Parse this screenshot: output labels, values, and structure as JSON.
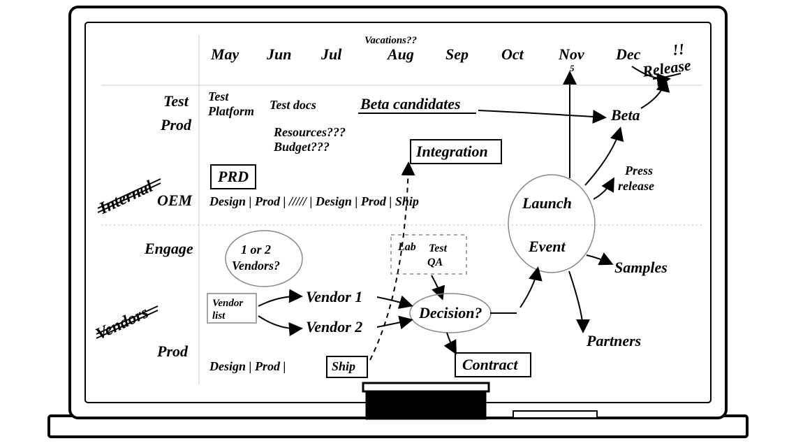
{
  "months": [
    "May",
    "Jun",
    "Jul",
    "Aug",
    "Sep",
    "Oct",
    "Nov",
    "Dec"
  ],
  "annotations": {
    "vacations": "Vacations??",
    "nov5": "5",
    "bang": "!!",
    "release": "Release"
  },
  "rows": {
    "internal_header": "Internal",
    "test": "Test",
    "prod1": "Prod",
    "oem": "OEM",
    "engage": "Engage",
    "vendors_header": "Vendors",
    "prod2": "Prod"
  },
  "labels": {
    "test_platform_1": "Test",
    "test_platform_2": "Platform",
    "test_docs": "Test docs",
    "beta_candidates": "Beta candidates",
    "beta": "Beta",
    "resources": "Resources???",
    "budget": "Budget???",
    "prd": "PRD",
    "integration": "Integration",
    "press_release_1": "Press",
    "press_release_2": "release",
    "oem_seq": "Design | Prod | ///// | Design | Prod | Ship",
    "launch": "Launch",
    "event": "Event",
    "one_or_two_1": "1 or 2",
    "one_or_two_2": "Vendors?",
    "lab": "Lab",
    "testqa_1": "Test",
    "testqa_2": "QA",
    "samples": "Samples",
    "vendor_list_1": "Vendor",
    "vendor_list_2": "list",
    "vendor1": "Vendor 1",
    "vendor2": "Vendor 2",
    "decision": "Decision?",
    "partners": "Partners",
    "contract": "Contract",
    "prod_seq_design": "Design | Prod |",
    "ship": "Ship"
  }
}
